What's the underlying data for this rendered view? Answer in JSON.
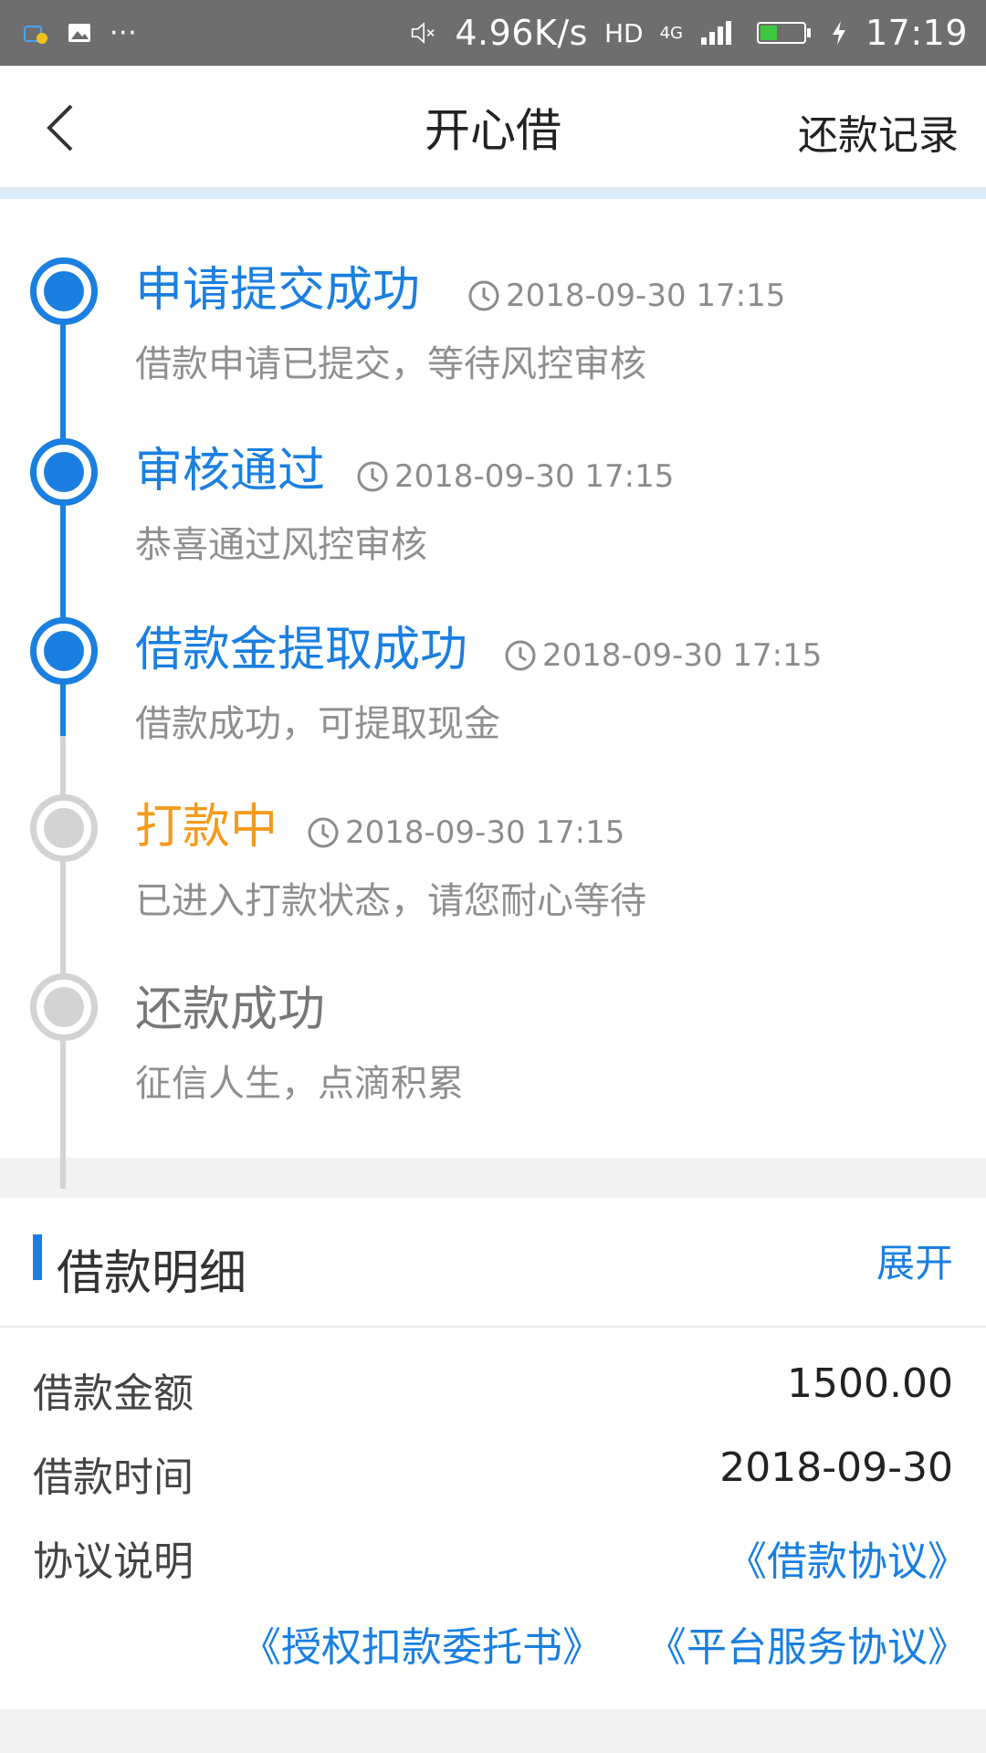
{
  "status_bar": {
    "speed": "4.96K/s",
    "hd": "HD",
    "network": "4G",
    "time": "17:19"
  },
  "nav": {
    "title": "开心借",
    "right_action": "还款记录"
  },
  "timeline": [
    {
      "title": "申请提交成功",
      "time": "2018-09-30 17:15",
      "desc": "借款申请已提交，等待风控审核",
      "state": "done"
    },
    {
      "title": "审核通过",
      "time": "2018-09-30 17:15",
      "desc": "恭喜通过风控审核",
      "state": "done"
    },
    {
      "title": "借款金提取成功",
      "time": "2018-09-30 17:15",
      "desc": "借款成功，可提取现金",
      "state": "done"
    },
    {
      "title": "打款中",
      "time": "2018-09-30 17:15",
      "desc": "已进入打款状态，请您耐心等待",
      "state": "current"
    },
    {
      "title": "还款成功",
      "time": "",
      "desc": "征信人生，点滴积累",
      "state": "pending"
    }
  ],
  "detail": {
    "title": "借款明细",
    "expand": "展开",
    "rows": [
      {
        "label": "借款金额",
        "value": "1500.00"
      },
      {
        "label": "借款时间",
        "value": "2018-09-30"
      },
      {
        "label": "协议说明",
        "value": "《借款协议》"
      }
    ],
    "more_links": [
      "《授权扣款委托书》",
      "《平台服务协议》"
    ]
  },
  "colors": {
    "primary": "#1a7fe0",
    "orange": "#f29b1d",
    "gray": "#d3d3d3"
  }
}
